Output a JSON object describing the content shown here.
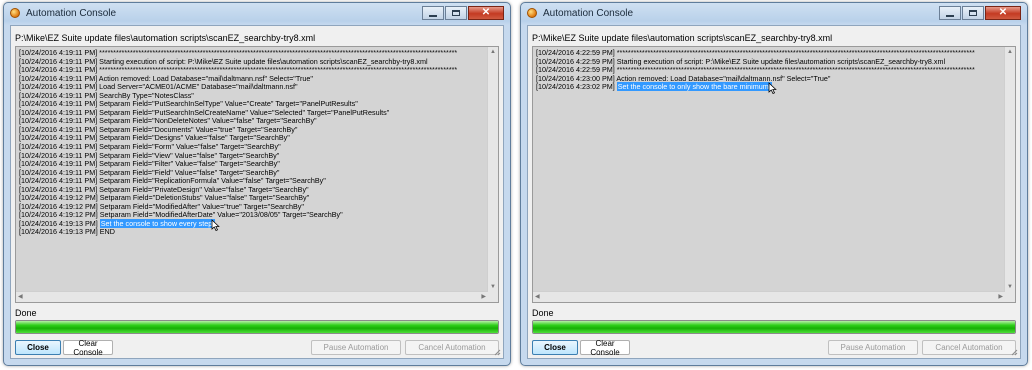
{
  "windows": [
    {
      "title": "Automation Console",
      "caption": {
        "close": "✕"
      },
      "path": "P:\\Mike\\EZ Suite update files\\automation scripts\\scanEZ_searchby-try8.xml",
      "lines": [
        {
          "text": "[10/24/2016 4:19:11 PM] ********************************************************************************************************************************"
        },
        {
          "text": "[10/24/2016 4:19:11 PM] Starting execution of script: P:\\Mike\\EZ Suite update files\\automation scripts\\scanEZ_searchby-try8.xml"
        },
        {
          "text": "[10/24/2016 4:19:11 PM] ********************************************************************************************************************************"
        },
        {
          "text": "[10/24/2016 4:19:11 PM] Action removed: Load Database=\"mail\\daltmann.nsf\" Select=\"True\""
        },
        {
          "text": "[10/24/2016 4:19:11 PM] Load Server=\"ACME01/ACME\" Database=\"mail\\daltmann.nsf\""
        },
        {
          "text": "[10/24/2016 4:19:11 PM] SearchBy Type=\"NotesClass\""
        },
        {
          "text": "[10/24/2016 4:19:11 PM] Setparam Field=\"PutSearchInSelType\" Value=\"Create\" Target=\"PanelPutResults\""
        },
        {
          "text": "[10/24/2016 4:19:11 PM] Setparam Field=\"PutSearchInSelCreateName\" Value=\"Selected\" Target=\"PanelPutResults\""
        },
        {
          "text": "[10/24/2016 4:19:11 PM] Setparam Field=\"NonDeleteNotes\" Value=\"false\" Target=\"SearchBy\""
        },
        {
          "text": "[10/24/2016 4:19:11 PM] Setparam Field=\"Documents\" Value=\"true\" Target=\"SearchBy\""
        },
        {
          "text": "[10/24/2016 4:19:11 PM] Setparam Field=\"Designs\" Value=\"false\" Target=\"SearchBy\""
        },
        {
          "text": "[10/24/2016 4:19:11 PM] Setparam Field=\"Form\" Value=\"false\" Target=\"SearchBy\""
        },
        {
          "text": "[10/24/2016 4:19:11 PM] Setparam Field=\"View\" Value=\"false\" Target=\"SearchBy\""
        },
        {
          "text": "[10/24/2016 4:19:11 PM] Setparam Field=\"Filter\" Value=\"false\" Target=\"SearchBy\""
        },
        {
          "text": "[10/24/2016 4:19:11 PM] Setparam Field=\"Field\" Value=\"false\" Target=\"SearchBy\""
        },
        {
          "text": "[10/24/2016 4:19:11 PM] Setparam Field=\"ReplicationFormula\" Value=\"false\" Target=\"SearchBy\""
        },
        {
          "text": "[10/24/2016 4:19:11 PM] Setparam Field=\"PrivateDesign\" Value=\"false\" Target=\"SearchBy\""
        },
        {
          "text": "[10/24/2016 4:19:12 PM] Setparam Field=\"DeletionStubs\" Value=\"false\" Target=\"SearchBy\""
        },
        {
          "text": "[10/24/2016 4:19:12 PM] Setparam Field=\"ModifiedAfter\" Value=\"true\" Target=\"SearchBy\""
        },
        {
          "text": "[10/24/2016 4:19:12 PM] Setparam Field=\"ModifiedAfterDate\" Value=\"2013/08/05\" Target=\"SearchBy\""
        },
        {
          "text": "[10/24/2016 4:19:13 PM] ",
          "highlight": "Set the console to show every step.",
          "cursor": true
        },
        {
          "text": "[10/24/2016 4:19:13 PM] END"
        }
      ],
      "status": "Done",
      "progress": 1.0,
      "buttons": {
        "close": "Close",
        "clear": "Clear Console",
        "pause": "Pause Automation",
        "cancel": "Cancel Automation"
      }
    },
    {
      "title": "Automation Console",
      "caption": {
        "close": "✕"
      },
      "path": "P:\\Mike\\EZ Suite update files\\automation scripts\\scanEZ_searchby-try8.xml",
      "lines": [
        {
          "text": "[10/24/2016 4:22:59 PM] ********************************************************************************************************************************"
        },
        {
          "text": "[10/24/2016 4:22:59 PM] Starting execution of script: P:\\Mike\\EZ Suite update files\\automation scripts\\scanEZ_searchby-try8.xml"
        },
        {
          "text": "[10/24/2016 4:22:59 PM] ********************************************************************************************************************************"
        },
        {
          "text": "[10/24/2016 4:23:00 PM] Action removed: Load Database=\"mail\\daltmann.nsf\" Select=\"True\""
        },
        {
          "text": "[10/24/2016 4:23:02 PM] ",
          "highlight": "Set the console to only show the bare minimum.",
          "cursor": true
        }
      ],
      "status": "Done",
      "progress": 1.0,
      "buttons": {
        "close": "Close",
        "clear": "Clear Console",
        "pause": "Pause Automation",
        "cancel": "Cancel Automation"
      }
    }
  ],
  "colors": {
    "progress": "#16b005",
    "selection": "#3399ff",
    "console_bg": "#d4d4d4"
  },
  "icons": [
    "app-icon",
    "minimize-icon",
    "maximize-icon",
    "close-icon",
    "mouse-cursor-icon",
    "resize-grip-icon"
  ]
}
